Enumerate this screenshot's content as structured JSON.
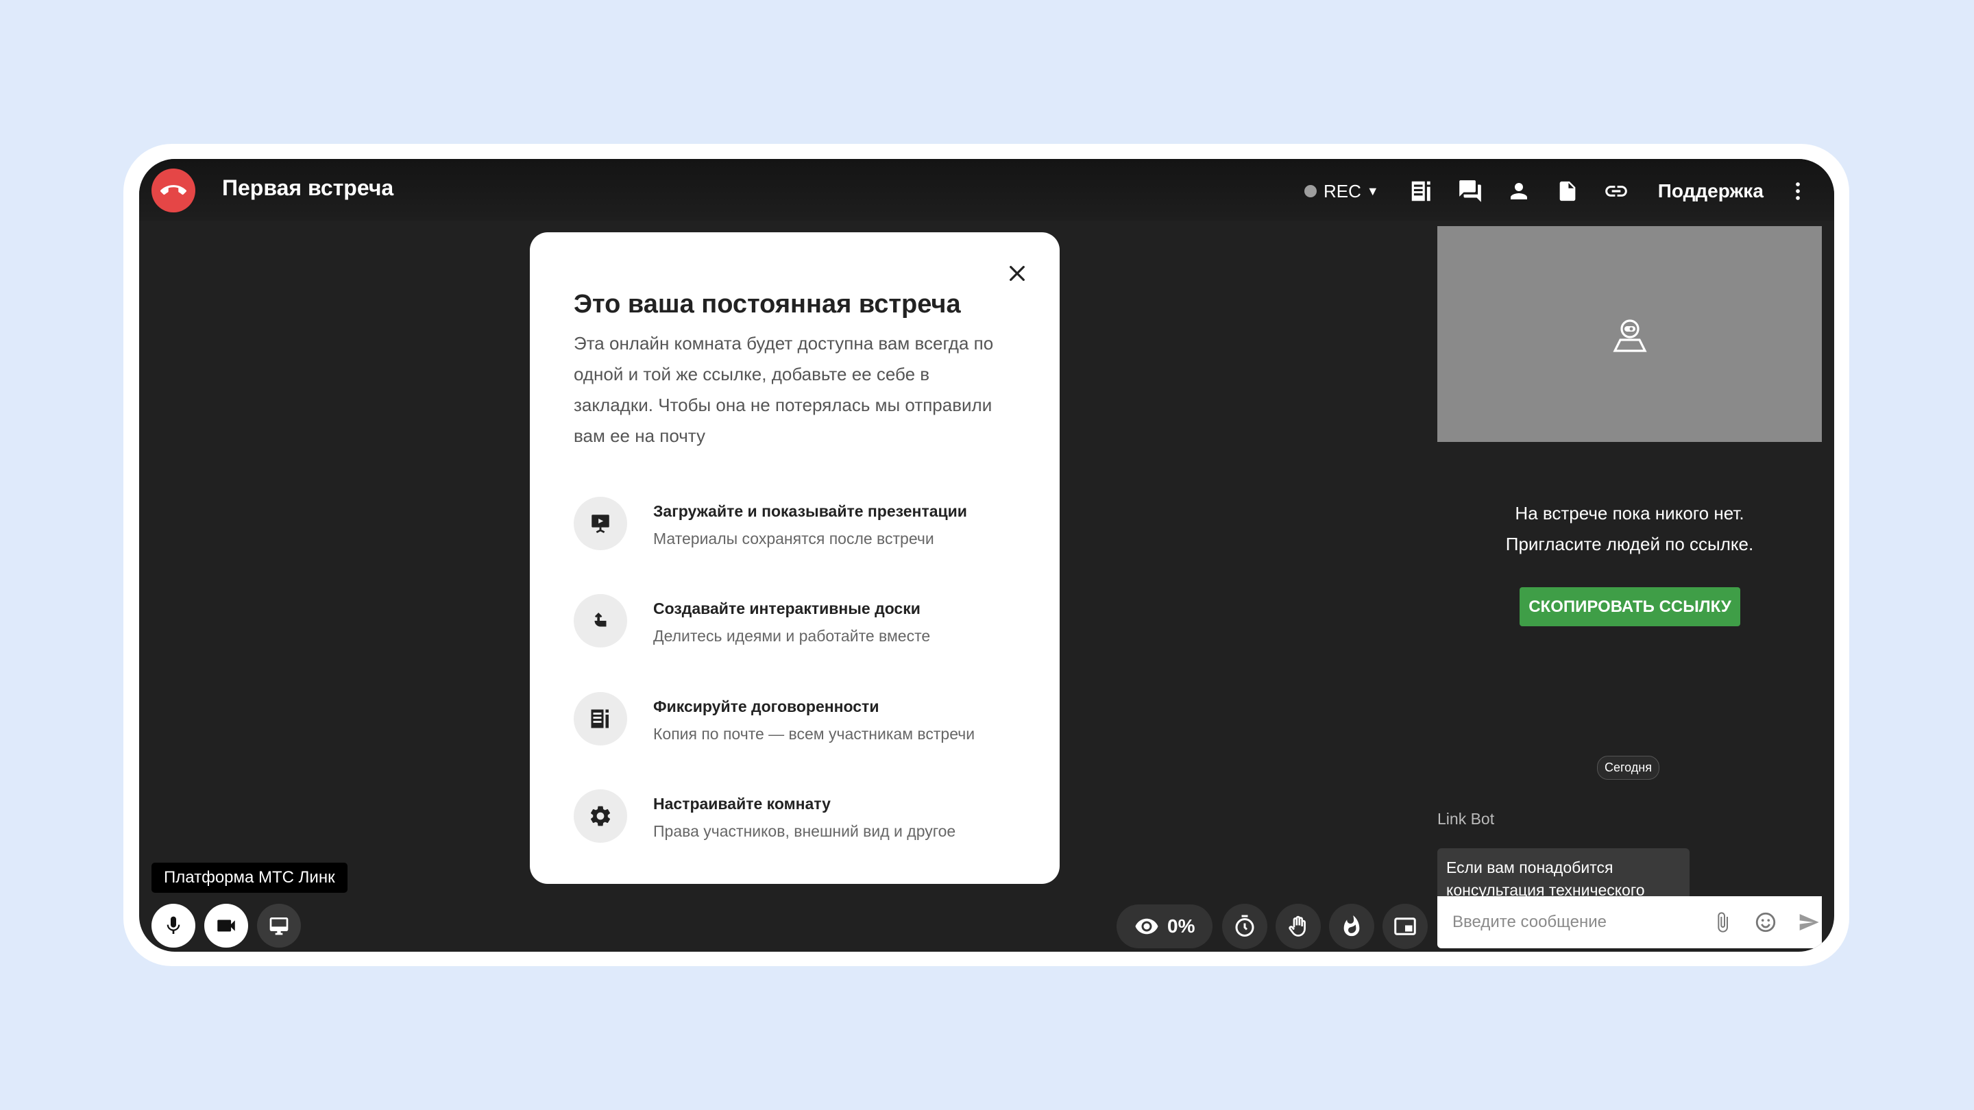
{
  "meeting": {
    "title": "Первая встреча"
  },
  "topbar": {
    "rec_label": "REC",
    "support_label": "Поддержка",
    "icons": [
      "agenda-icon",
      "chat-icon",
      "participants-icon",
      "document-icon",
      "link-icon",
      "more-icon"
    ]
  },
  "modal": {
    "title": "Это ваша постоянная встреча",
    "description": "Эта онлайн комната будет доступна вам всегда по одной и той же ссылке, добавьте ее себе в закладки. Чтобы она не потерялась мы отправили вам ее на почту",
    "features": [
      {
        "title": "Загружайте и показывайте презентации",
        "subtitle": "Материалы сохранятся после встречи",
        "icon": "presentation-icon"
      },
      {
        "title": "Создавайте интерактивные доски",
        "subtitle": "Делитесь идеями и работайте вместе",
        "icon": "whiteboard-icon"
      },
      {
        "title": "Фиксируйте договоренности",
        "subtitle": "Копия по почте — всем участникам встречи",
        "icon": "agreements-icon"
      },
      {
        "title": "Настраивайте комнату",
        "subtitle": "Права участников, внешний вид и другое",
        "icon": "settings-icon"
      }
    ]
  },
  "sidebar": {
    "empty_line1": "На встрече пока никого нет.",
    "empty_line2": "Пригласите людей по ссылке.",
    "copy_link_label": "СКОПИРОВАТЬ ССЫЛКУ",
    "date_badge": "Сегодня",
    "bot_name": "Link Bot",
    "bot_message": "Если вам понадобится консультация технического",
    "input_placeholder": "Введите сообщение"
  },
  "bottom": {
    "platform_label": "Платформа МТС Линк",
    "attention_value": "0%"
  },
  "colors": {
    "background": "#dfeafb",
    "app_bg": "#212121",
    "hangup": "#e54646",
    "accent_green": "#3f9e47"
  }
}
